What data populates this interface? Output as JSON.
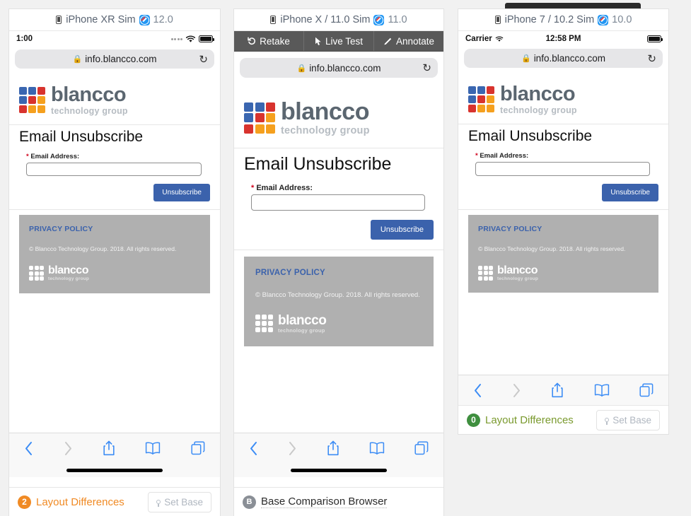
{
  "app": {
    "background_color": "#f1f1f1",
    "accent_orange": "#f08a24",
    "accent_green": "#3f8f3f",
    "accent_blue": "#3b62ac"
  },
  "action_toolbar": {
    "buttons": [
      {
        "label": "Retake",
        "icon": "undo-icon"
      },
      {
        "label": "Live Test",
        "icon": "cursor-icon"
      },
      {
        "label": "Annotate",
        "icon": "pencil-icon"
      }
    ]
  },
  "page": {
    "logo": {
      "word_top": "blancco",
      "word_bottom": "technology group",
      "grid_colors": [
        "#3a66b0",
        "#3a66b0",
        "#d8332e",
        "#3a66b0",
        "#d8332e",
        "#f5a01e",
        "#d8332e",
        "#f5a01e",
        "#f5a01e"
      ]
    },
    "form": {
      "title": "Email Unsubscribe",
      "required_mark": "*",
      "email_label": "Email Address:",
      "email_value": "",
      "email_placeholder": "",
      "submit_label": "Unsubscribe"
    },
    "privacy": {
      "heading": "PRIVACY POLICY",
      "copyright": "© Blancco Technology Group. 2018. All rights reserved.",
      "logo_word_top": "blancco",
      "logo_word_bottom": "technology group"
    }
  },
  "panels": [
    {
      "id": "panel-1",
      "device_name": "iPhone XR Sim",
      "browser_icon": "safari-icon",
      "browser_version": "12.0",
      "has_action_toolbar": false,
      "has_notch_popover": false,
      "status_bar": {
        "style": "modern",
        "time": "1:00",
        "carrier": "",
        "signal_icon": "dots-signal-icon",
        "wifi_icon": "wifi-icon",
        "battery_icon": "battery-icon"
      },
      "url_bar": {
        "lock_icon": "lock-icon",
        "url": "info.blancco.com",
        "reload_icon": "reload-icon"
      },
      "safari_toolbar": {
        "icons": [
          "back-icon",
          "forward-icon",
          "share-icon",
          "bookmarks-icon",
          "tabs-icon"
        ],
        "back_enabled": true,
        "forward_enabled": false,
        "home_indicator": true
      },
      "footer": {
        "type": "layout-differences",
        "badge": "2",
        "badge_color": "orange",
        "label": "Layout Differences",
        "set_base_label": "Set Base",
        "set_base_icon": "pin-icon"
      }
    },
    {
      "id": "panel-2",
      "device_name": "iPhone X / 11.0 Sim",
      "browser_icon": "safari-icon",
      "browser_version": "11.0",
      "has_action_toolbar": true,
      "has_notch_popover": true,
      "status_bar": null,
      "url_bar": {
        "lock_icon": "lock-icon",
        "url": "info.blancco.com",
        "reload_icon": "reload-icon"
      },
      "safari_toolbar": {
        "icons": [
          "back-icon",
          "forward-icon",
          "share-icon",
          "bookmarks-icon",
          "tabs-icon"
        ],
        "back_enabled": true,
        "forward_enabled": false,
        "home_indicator": true
      },
      "footer": {
        "type": "base-browser",
        "badge": "B",
        "badge_color": "gray",
        "label": "Base Comparison Browser",
        "set_base_label": "",
        "set_base_icon": ""
      }
    },
    {
      "id": "panel-3",
      "device_name": "iPhone 7 / 10.2 Sim",
      "browser_icon": "safari-icon",
      "browser_version": "10.0",
      "has_action_toolbar": false,
      "has_notch_popover": false,
      "status_bar": {
        "style": "legacy",
        "time": "12:58 PM",
        "carrier": "Carrier",
        "signal_icon": "wifi-icon",
        "wifi_icon": "wifi-icon",
        "battery_icon": "battery-icon"
      },
      "url_bar": {
        "lock_icon": "lock-icon",
        "url": "info.blancco.com",
        "reload_icon": "reload-icon"
      },
      "safari_toolbar": {
        "icons": [
          "back-icon",
          "forward-icon",
          "share-icon",
          "bookmarks-icon",
          "tabs-icon"
        ],
        "back_enabled": true,
        "forward_enabled": false,
        "home_indicator": false
      },
      "footer": {
        "type": "layout-differences",
        "badge": "0",
        "badge_color": "green",
        "label": "Layout Differences",
        "set_base_label": "Set Base",
        "set_base_icon": "pin-icon"
      }
    }
  ]
}
